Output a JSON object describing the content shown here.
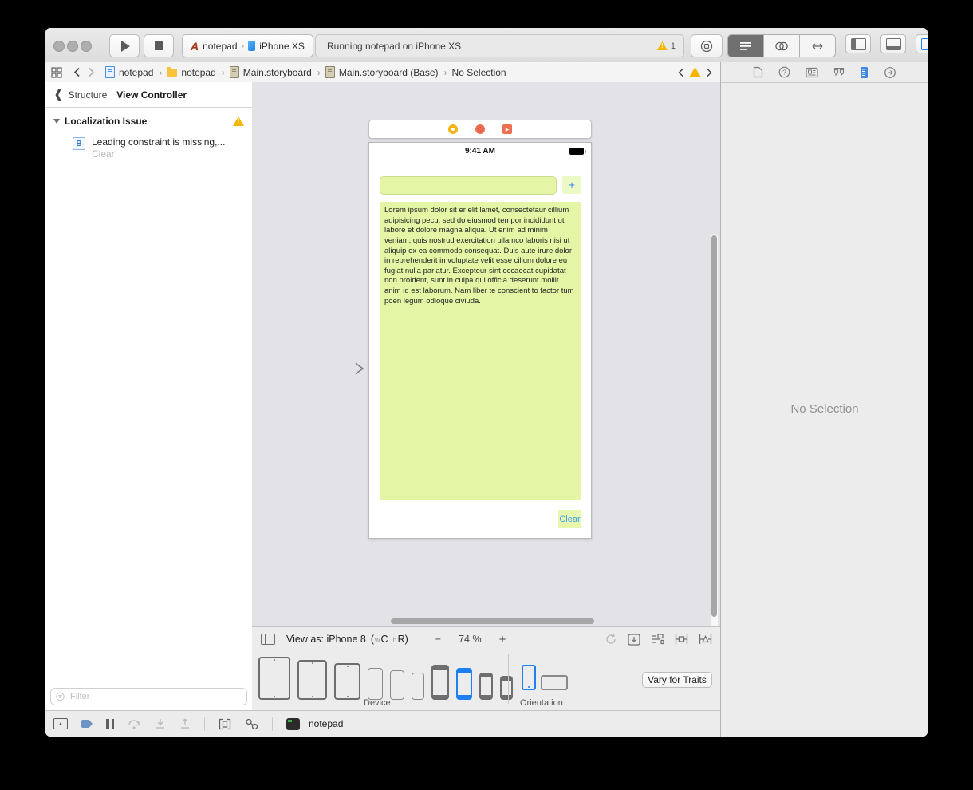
{
  "toolbar": {
    "scheme": {
      "project": "notepad",
      "separator": "›",
      "device": "iPhone XS"
    },
    "status": {
      "text": "Running notepad on iPhone XS",
      "warning_count": "1"
    }
  },
  "jumpbar": {
    "crumbs": [
      {
        "label": "notepad"
      },
      {
        "label": "notepad"
      },
      {
        "label": "Main.storyboard"
      },
      {
        "label": "Main.storyboard (Base)"
      },
      {
        "label": "No Selection"
      }
    ]
  },
  "sidebar": {
    "back_label": "Structure",
    "title": "View Controller",
    "group_label": "Localization Issue",
    "issue": {
      "badge": "B",
      "text": "Leading constraint is missing,...",
      "action": "Clear"
    },
    "filter_placeholder": "Filter"
  },
  "canvas": {
    "phone": {
      "time": "9:41 AM",
      "plus_label": "+",
      "note_text": "Lorem ipsum dolor sit er elit lamet, consectetaur cillium adipisicing pecu, sed do eiusmod tempor incididunt ut labore et dolore magna aliqua. Ut enim ad minim veniam, quis nostrud exercitation ullamco laboris nisi ut aliquip ex ea commodo consequat. Duis aute irure dolor in reprehenderit in voluptate velit esse cillum dolore eu fugiat nulla pariatur. Excepteur sint occaecat cupidatat non proident, sunt in culpa qui officia deserunt mollit anim id est laborum. Nam liber te conscient to factor tum poen legum odioque civiuda.",
      "clear_label": "Clear"
    },
    "bar": {
      "view_as": "View as: iPhone 8",
      "trait_open": "(",
      "trait_w_small": "w",
      "trait_w": "C",
      "trait_h_small": "h",
      "trait_h": "R)",
      "minus": "−",
      "zoom_level": "74 %",
      "plus": "+"
    }
  },
  "device_bar": {
    "device_label": "Device",
    "orientation_label": "Orientation",
    "vary_button": "Vary for Traits"
  },
  "debug_bar": {
    "process": "notepad"
  },
  "inspector": {
    "no_selection": "No Selection"
  },
  "colors": {
    "accent_blue": "#1d80f0",
    "warning_yellow": "#f7b500",
    "note_green": "#e4f6a5"
  }
}
